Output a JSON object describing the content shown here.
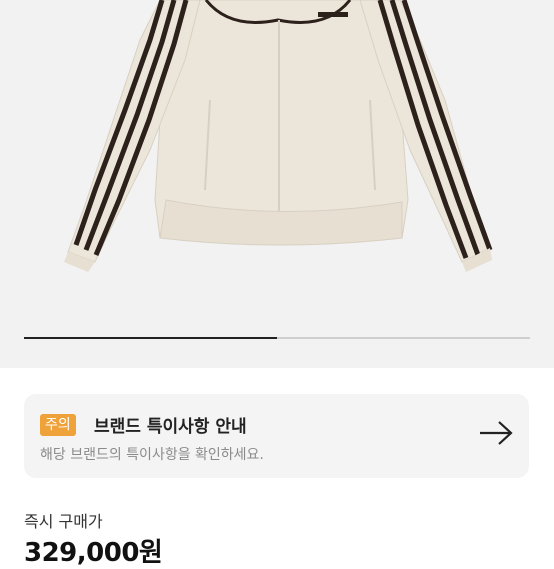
{
  "product": {
    "image_alt_icon": "track-jacket-image",
    "carousel_progress": 0.5
  },
  "notice": {
    "badge": "주의",
    "title": "브랜드 특이사항 안내",
    "description": "해당 브랜드의 특이사항을 확인하세요.",
    "arrow_icon": "arrow-right-icon"
  },
  "price": {
    "label": "즉시 구매가",
    "value": "329,000원"
  },
  "colors": {
    "badge": "#f0a23a",
    "jacket": "#ece6da",
    "stripes": "#2d211b"
  }
}
